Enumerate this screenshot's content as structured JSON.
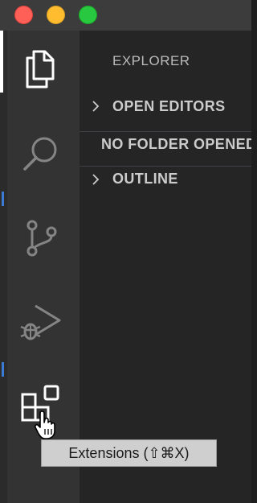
{
  "window": {
    "traffic_lights": [
      "close",
      "minimize",
      "zoom"
    ],
    "colors": {
      "close": "#fe5f57",
      "minimize": "#febc2e",
      "zoom": "#28c840",
      "activity_bar": "#333333",
      "sidebar": "#252526",
      "titlebar": "#3c3c3c"
    }
  },
  "activity_bar": {
    "items": [
      {
        "name": "explorer",
        "icon": "files-icon",
        "active": true
      },
      {
        "name": "search",
        "icon": "search-icon",
        "active": false
      },
      {
        "name": "source-control",
        "icon": "source-control-icon",
        "active": false
      },
      {
        "name": "run-debug",
        "icon": "debug-icon",
        "active": false
      },
      {
        "name": "extensions",
        "icon": "extensions-icon",
        "active": false,
        "hovered": true
      }
    ]
  },
  "sidebar": {
    "title": "EXPLORER",
    "sections": [
      {
        "label": "OPEN EDITORS",
        "expanded": false
      },
      {
        "label": "NO FOLDER OPENED",
        "expanded": false
      },
      {
        "label": "OUTLINE",
        "expanded": false
      }
    ]
  },
  "tooltip": {
    "text": "Extensions (⇧⌘X)"
  }
}
